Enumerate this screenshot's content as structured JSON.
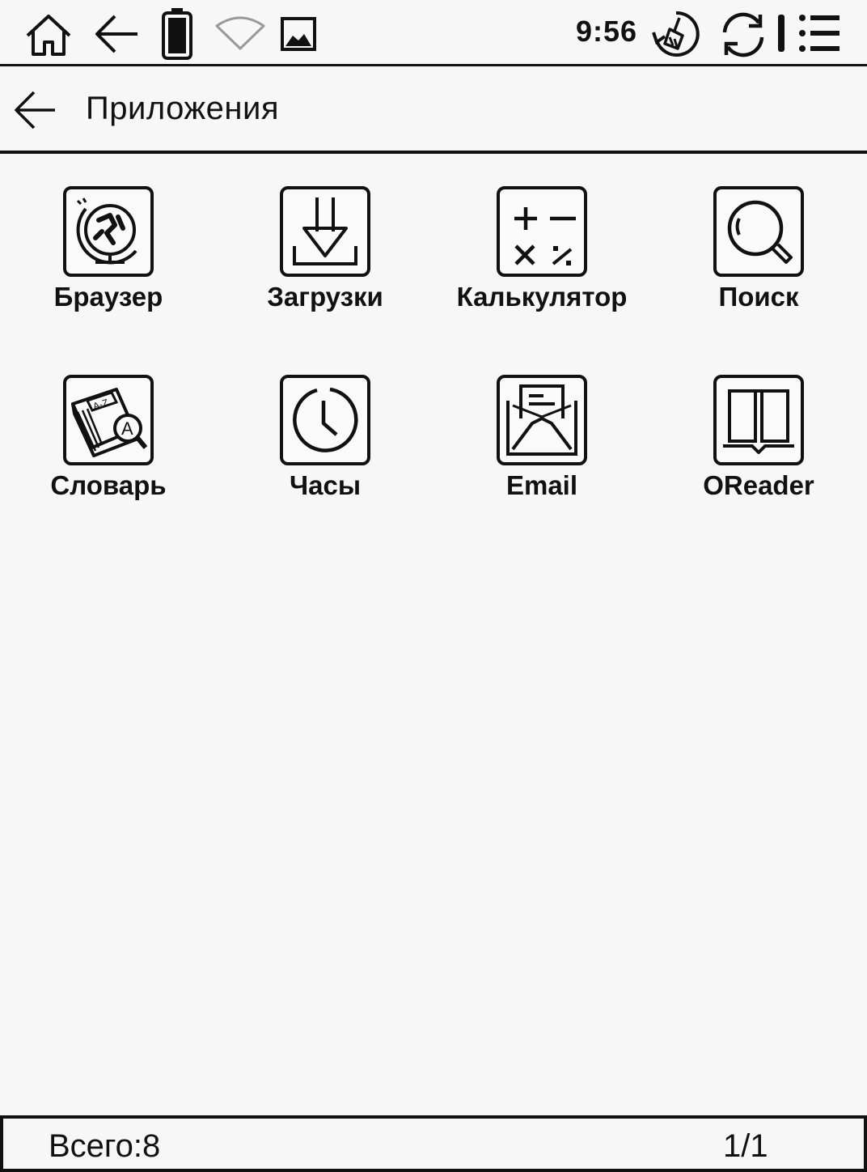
{
  "status_bar": {
    "time": "9:56",
    "icons": [
      "home-icon",
      "back-arrow-icon",
      "battery-icon",
      "wifi-icon",
      "image-icon",
      "clean-icon",
      "sync-icon",
      "menu-icon"
    ]
  },
  "header": {
    "title": "Приложения",
    "back_icon": "back-arrow-icon"
  },
  "apps": [
    {
      "label": "Браузер",
      "icon": "browser-globe-icon"
    },
    {
      "label": "Загрузки",
      "icon": "download-icon"
    },
    {
      "label": "Калькулятор",
      "icon": "calculator-icon"
    },
    {
      "label": "Поиск",
      "icon": "search-icon"
    },
    {
      "label": "Словарь",
      "icon": "dictionary-icon"
    },
    {
      "label": "Часы",
      "icon": "clock-icon"
    },
    {
      "label": "Email",
      "icon": "email-icon"
    },
    {
      "label": "OReader",
      "icon": "book-icon"
    }
  ],
  "footer": {
    "total": "Всего:8",
    "pages": "1/1"
  }
}
